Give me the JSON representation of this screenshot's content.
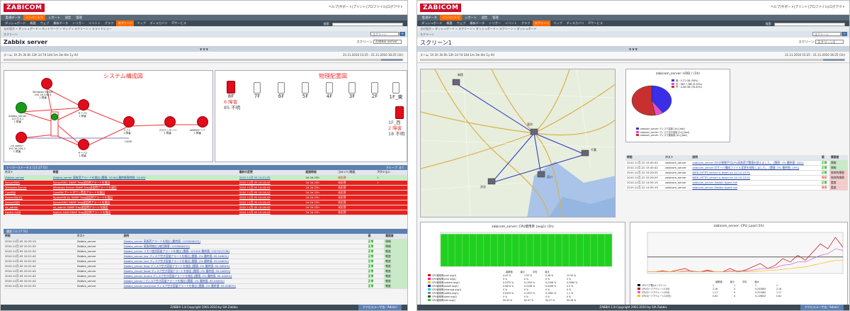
{
  "common": {
    "logo": "ZABICOM",
    "top_links": "ヘルプ|サポート|プリント|プロファイル|ログアウト",
    "search_label": "検索",
    "footer": "ZABBIX 1.8 Copyright 2001-2010 by SIA Zabbix",
    "footer_right": "アクセスユーザ名: 'Admin'"
  },
  "left": {
    "menu1": [
      "監視データ",
      "インベントリ",
      "レポート",
      "設定",
      "管理"
    ],
    "menu1_active": 1,
    "menu2": [
      "ダッシュボード",
      "概要",
      "ウェブ",
      "最新データ",
      "トリガー",
      "イベント",
      "グラフ",
      "スクリーン",
      "マップ",
      "ディスカバリ",
      "ITサービス"
    ],
    "menu2_active": 7,
    "breadcrumb": "元の見方 » ダッシュボード » ネットワーク » マップ » スクリーン » スライドショー",
    "subbar": "スクリーン",
    "subselect": "スクリーン",
    "title": "Zabbix server",
    "title_right_label": "スクリーン",
    "title_right_value": "Zabbix server",
    "timebar": "▼ ▼ ▼",
    "zoom": "ズーム: 1h 2h 3h 6h 12h 1d 7d 14d 1m 3m 6m 1y All",
    "datetime": "21.11.2010 15:25 - 21.11.2010 16:25 (1h)",
    "map_title": "システム構成図",
    "floor_title": "物理配置図",
    "nodes": [
      {
        "label": "Windows Server",
        "sub": "192.16.256.4",
        "status": "1 障害"
      },
      {
        "label": "サーバ1",
        "sub": "",
        "status": "1 障害"
      },
      {
        "label": "Zabbix_server",
        "sub": "127.0.0.1",
        "status": "1 障害"
      },
      {
        "label": "ルータ",
        "sub": "",
        "status": ""
      },
      {
        "label": "ユフト",
        "sub": "",
        "status": "1 障害"
      },
      {
        "label": "プロクシサーバ",
        "sub": "",
        "status": "1 障害"
      },
      {
        "label": "WWWサーバ",
        "sub": "",
        "status": "1 障害"
      },
      {
        "label": "nk_admin",
        "sub": "192.16.256.1",
        "status": "1 障害"
      },
      {
        "label": "サーバ2",
        "sub": "",
        "status": "1 障害"
      },
      {
        "label": "L3SW",
        "sub": "",
        "status": ""
      }
    ],
    "floors": [
      "8F",
      "7F",
      "6F",
      "5F",
      "4F",
      "3F",
      "2F",
      "1F_東"
    ],
    "floor_alarm": {
      "count": "6 障害",
      "unknown": "85 不明"
    },
    "floor_west": {
      "label": "1F_西",
      "count": "2 障害",
      "unknown": "18 不明"
    },
    "trigger_header": "トリガーステータス [11:27:51]",
    "trigger_header_right": "グループ: 全て",
    "trigger_cols": [
      "ホスト",
      "障害",
      "最終の変更",
      "経過時間",
      "コメント/対応",
      "アクション"
    ],
    "trigger_rows": [
      {
        "host": "Zabbix_server",
        "problem": "Zabbix_server 高負荷アラートを検出  [閾値: 10:00]  最終障害時間: 14:00]",
        "time": "2010 11月 05 10:21:32",
        "age": "2d 2d 23h",
        "ack": "未応答",
        "act": "1",
        "red": false
      },
      {
        "host": "ServerSW1",
        "problem": "ServerSW1 SNMP Trap送信時アラートを検出",
        "time": "2010 11月 05 10:18:43",
        "age": "2d 2d 23h",
        "ack": "未応答",
        "act": "1",
        "red": true
      },
      {
        "host": "Windows Server",
        "problem": "Windows Server SNMP Trap送信時アラートを検出",
        "time": "2010 11月 05 10:18:43",
        "age": "2d 2d 23h",
        "ack": "未応答",
        "act": "",
        "red": true
      },
      {
        "host": "CoreSW",
        "problem": "CoreSW ポートダウン受信アラートを検出",
        "time": "2010 11月 05 10:18:43",
        "age": "2d 2d 23h",
        "ack": "未応答",
        "act": "",
        "red": true
      },
      {
        "host": "RouterSW-A1",
        "problem": "RouterSW-A1 SNMP Trap送信時アラートを検出",
        "time": "2010 11月 05 10:18:43",
        "age": "2d 2d 23h",
        "ack": "未応答",
        "act": "",
        "red": true
      },
      {
        "host": "ServerSW2",
        "problem": "ServerSW2 SNMP Trap送信時アラートを検出",
        "time": "2010 11月 05 10:18:43",
        "age": "2d 2d 23h",
        "ack": "未応答",
        "act": "",
        "red": true
      },
      {
        "host": "nk_admin",
        "problem": "nk_admin SNMP Trap送信時アラートを検出",
        "time": "2010 11月 05 10:18:43",
        "age": "2d 2d 23h",
        "ack": "未応答",
        "act": "",
        "red": true
      },
      {
        "host": "Switch-HUB",
        "problem": "Switch-HUB SNMP Trap送信時アラートを検出",
        "time": "2010 11月 05 10:18:43",
        "age": "2d 2d 23h",
        "ack": "未応答",
        "act": "",
        "red": true
      }
    ],
    "event_header": "履歴 [11:27:51]",
    "event_cols": [
      "時間",
      "ホスト",
      "説明",
      "値",
      "重要度"
    ],
    "event_rows": [
      {
        "t": "2010.11月.05 10:25:14",
        "h": "Zabbix_server",
        "d": "Zabbix_server 高負荷アラートを検出  [最終値: 1235848431]",
        "v": "正常",
        "s": "情報"
      },
      {
        "t": "2010.11月.05 10:21:32",
        "h": "Zabbix_server",
        "d": "Zabbix_server 高負荷検出  [前回障害: 1235848431]",
        "v": "正常",
        "s": "情報"
      },
      {
        "t": "2010.11月.05 10:21:32",
        "h": "Zabbix_server",
        "d": "Zabbix_server メモリ使用容量アラートを検出  [閾値: 102400  最終値: 1347427238]",
        "v": "正常",
        "s": "軽度"
      },
      {
        "t": "2010.11月.05 10:21:42",
        "h": "Zabbix_server",
        "d": "Zabbix_server /usr ディスク空き容量アラートを検出  [閾値: 2%  最終値: 95.5480%]",
        "v": "正常",
        "s": "軽度"
      },
      {
        "t": "2010.11月.05 10:21:42",
        "h": "Zabbix_server",
        "d": "Zabbix_server /var ディスク空き容量アラートを検出  [閾値: 2%  最終値: 95.5480%]",
        "v": "正常",
        "s": "軽度"
      },
      {
        "t": "2010.11月.05 10:21:42",
        "h": "Zabbix_server",
        "d": "Zabbix_server /tmp ディスク空き容量アラートを検出  [閾値: 2%  最終値: 95.5480%]",
        "v": "正常",
        "s": "軽度"
      },
      {
        "t": "2010.11月.05 10:21:42",
        "h": "Zabbix_server",
        "d": "Zabbix_server /boot ディスク空き容量アラートを検出  [閾値: 2%  最終値: 95.5480%]",
        "v": "正常",
        "s": "軽度"
      },
      {
        "t": "2010.11月.05 10:21:42",
        "h": "Zabbix_server",
        "d": "Zabbix_server /home ディスク空き容量アラートを検出  [閾値: 2%  最終値: 95.5480%]",
        "v": "正常",
        "s": "軽度"
      },
      {
        "t": "2010.11月.05 10:21:42",
        "h": "Zabbix_server",
        "d": "Zabbix_server / ディスク空き容量アラートを検出  [閾値: 2%  最終値: 95.5480%]",
        "v": "正常",
        "s": "軽度"
      },
      {
        "t": "2010.11月.05 10:21:32",
        "h": "Zabbix_server",
        "d": "Zabbix_server /usr/local ディスク空き容量アラートを検出  [閾値: 2%  最終値: 95.5480%]",
        "v": "正常",
        "s": "軽度"
      }
    ]
  },
  "right": {
    "menu1": [
      "監視データ",
      "インベントリ",
      "レポート",
      "設定",
      "管理"
    ],
    "menu1_active": 1,
    "menu2": [
      "ダッシュボード",
      "概要",
      "ウェブ",
      "最新データ",
      "トリガー",
      "イベント",
      "グラフ",
      "スクリーン",
      "マップ",
      "ディスカバリ",
      "ITサービス"
    ],
    "menu2_active": 7,
    "breadcrumb": "元の見方 » ダッシュボード » スクリーン » ダッシュボード » スクリーン » ダッシュボード",
    "subbar": "スクリーン",
    "subselect": "スクリーン",
    "title": "スクリーン1",
    "title_right_label": "スクリーン",
    "title_right_value": "スクリーン1",
    "timebar": "▼ ▼ ▼",
    "zoom": "ズーム: 1h 2h 3h 6h 12h 1d 7d 14d 1m 3m 6m 1y All",
    "datetime": "21.11.2010 15:25 - 21.11.2010 16:25 (1h)",
    "map_labels": [
      "新宿",
      "渋谷",
      "東京",
      "品川",
      "千葉"
    ],
    "pie": {
      "title": "zabicom_server: HDD / (1h)",
      "legend": [
        "使 : 5.71 GB (58%)",
        "空 : 987.7 MB (9.55%)",
        "予 : 4.58 GB (76.32%)"
      ],
      "bottom": [
        "zabicom_server: ディスク容量 [1h] [last]",
        "zabicom_server: ディスク空き容量 [1h] [last]",
        "zabicom_server: ディスク使用量 [1h] [last]"
      ]
    },
    "chart_data": [
      {
        "type": "pie",
        "title": "zabicom_server: HDD / (1h)",
        "categories": [
          "使",
          "空",
          "予"
        ],
        "values": [
          58,
          9.55,
          76.32
        ],
        "colors": [
          "#3b2ee8",
          "#e84bcf",
          "#c83030"
        ]
      },
      {
        "type": "area",
        "title": "zabicom_server: CPU使用率 (avg1) (1h)",
        "ylim": [
          0,
          100
        ],
        "series": [
          {
            "name": "CPU使用率(idle avg1)",
            "values": [
              95,
              95,
              95,
              95,
              95,
              95,
              95,
              95,
              95,
              95,
              95,
              95,
              95,
              95,
              95,
              95,
              95,
              95,
              95,
              95,
              95,
              95,
              95,
              95
            ]
          }
        ],
        "color": "#20d020"
      },
      {
        "type": "line",
        "title": "zabicom_server: CPU_Load (1h)",
        "series": [
          {
            "name": "CPUロード平均(1分)",
            "values": [
              0.1,
              0.1,
              0.15,
              0.1,
              0.2,
              0.3,
              0.1,
              0.1,
              0.2,
              0.1,
              0.1,
              0.3,
              0.1,
              0.2,
              0.4,
              0.6,
              0.3,
              0.5,
              0.9,
              0.7,
              1.1,
              0.8,
              1.3,
              1.8,
              1.5,
              2.2,
              1.6
            ]
          },
          {
            "name": "CPUロード平均(5分)",
            "values": [
              0.1,
              0.1,
              0.1,
              0.1,
              0.1,
              0.15,
              0.15,
              0.1,
              0.15,
              0.1,
              0.1,
              0.15,
              0.15,
              0.15,
              0.2,
              0.3,
              0.3,
              0.35,
              0.5,
              0.55,
              0.7,
              0.7,
              0.9,
              1.1,
              1.2,
              1.5,
              1.4
            ]
          },
          {
            "name": "CPUロード平均(15分)",
            "values": [
              0.1,
              0.1,
              0.1,
              0.1,
              0.1,
              0.1,
              0.1,
              0.1,
              0.1,
              0.1,
              0.1,
              0.1,
              0.1,
              0.1,
              0.12,
              0.15,
              0.18,
              0.2,
              0.25,
              0.3,
              0.35,
              0.4,
              0.5,
              0.6,
              0.7,
              0.8,
              0.8
            ]
          }
        ],
        "ylim": [
          0,
          2.5
        ]
      }
    ],
    "event_cols": [
      "時間",
      "ホスト",
      "説明",
      "値",
      "重要度"
    ],
    "event_rows": [
      {
        "t": "2010.11月.22 15:45:42",
        "h": "zabicom_server",
        "d": "zabicom_server の5分移動平均CPU高負荷が閾値を超えました。 [閾値: 5%  最終値: 32%]",
        "v": "正常",
        "s": "情報",
        "n": false
      },
      {
        "t": "2010.11月.22 15:45:42",
        "h": "zabicom_server",
        "d": "zabicom_server のサーバ構成ファイル変更を検知しました。 [閾値: 5%  最終値: 29%]",
        "v": "正常",
        "s": "情報",
        "n": false
      },
      {
        "t": "2010.11月.22 15:29:25",
        "h": "zabicom_server",
        "d": "WEB (HTTP) server is down on 10.10.10.51",
        "v": "正常",
        "s": "致命的障害",
        "n": true
      },
      {
        "t": "2010.11月.22 15:29:25",
        "h": "zabicom_server",
        "d": "WEB (HTTP) server is down on 10.10.10.51",
        "v": "障害",
        "s": "致命的障害",
        "n": true
      },
      {
        "t": "2010.11月.22 14:55:19",
        "h": "zabicom_server",
        "d": "zabicom_server  Zabbix Agent fail",
        "v": "正常",
        "s": "重度",
        "n": true
      },
      {
        "t": "2010.11月.22 14:55:19",
        "h": "zabicom_server",
        "d": "zabicom_server  Zabbix Agent fail",
        "v": "障害",
        "s": "重度",
        "n": true
      }
    ],
    "cpu_title": "zabicom_server: CPU使用率 (avg1) (1h)",
    "cpu_legend": [
      "CPU使用率(user avg1)",
      "CPU使用率(nice avg1)",
      "CPU使用率(system avg1)",
      "CPU使用率(iowait avg1)",
      "CPU使用率(interrupt avg1)",
      "CPU使用率(softirq avg1)",
      "CPU使用率(steal avg1)",
      "CPU使用率(idle avg1)"
    ],
    "cpu_legend_colors": [
      "#c00",
      "#f0a",
      "#fb0",
      "#00c",
      "#0cc",
      "#888",
      "#444",
      "#2c2"
    ],
    "cpu_stats_head": [
      "最新値",
      "最小",
      "平均",
      "最大"
    ],
    "cpu_stats": [
      [
        "4.43 %",
        "1.93 %",
        "2.46 %",
        "12.55 %"
      ],
      [
        "0 %",
        "0 %",
        "0 %",
        "0 %"
      ],
      [
        "0.2575 %",
        "0.1355 %",
        "0.2108 %",
        "0.2569 %"
      ],
      [
        "0.0874 %",
        "0.0156 %",
        "0.0438 %",
        "0.5 %"
      ],
      [
        "0 %",
        "0 %",
        "0 %",
        "0 %"
      ],
      [
        "0.0525 %",
        "0.1937 %",
        "0.1062 %",
        "1.1 %"
      ],
      [
        "0 %",
        "0 %",
        "0 %",
        "0 %"
      ],
      [
        "95.55 %",
        "82.47 %",
        "94.27 %",
        "95.28 %"
      ]
    ],
    "load_title": "zabicom_server: CPU_Load (1h)",
    "load_legend": [
      "CPUコア数(オンライン)",
      "CPUロードアベレージ(1分)",
      "CPUロードアベレージ(5分)",
      "CPUロードアベレージ(15分)"
    ],
    "load_legend_colors": [
      "#000",
      "#c00",
      "#c6c",
      "#fb0"
    ],
    "load_stats_head": [
      "最新値",
      "最小",
      "平均",
      "最大"
    ],
    "load_stats": [
      [
        "1",
        "1",
        "1",
        "1"
      ],
      [
        "2.16",
        "0",
        "0.252605",
        "2.16"
      ],
      [
        "1.17",
        "0",
        "0.221082",
        "1.17"
      ],
      [
        "0.62",
        "0",
        "0.119832",
        "0.62"
      ]
    ]
  }
}
